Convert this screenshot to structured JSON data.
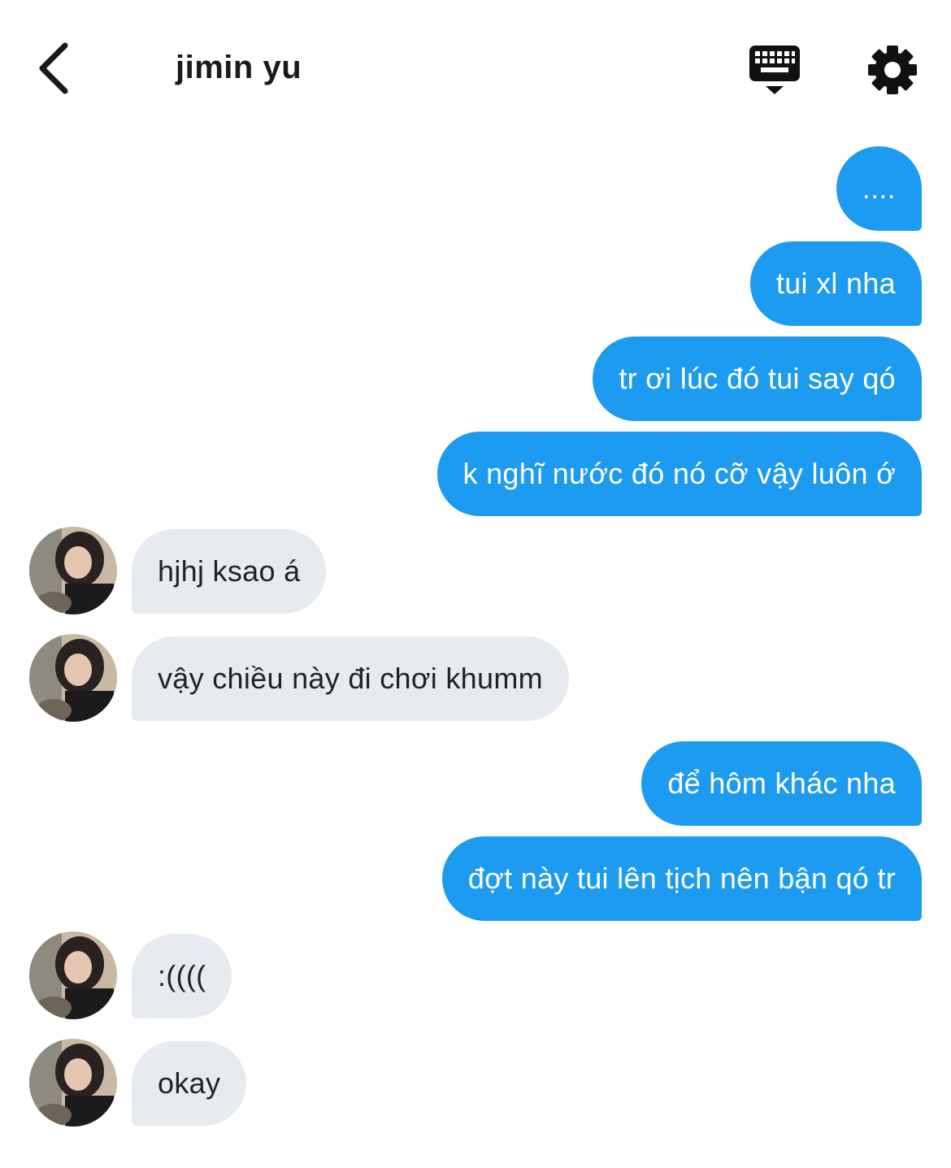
{
  "header": {
    "title": "jimin yu"
  },
  "icons": {
    "back": "chevron-left-icon",
    "keyboard": "keyboard-icon",
    "settings": "gear-icon"
  },
  "colors": {
    "outgoing_bubble": "#1d9bf0",
    "incoming_bubble": "#e7ebef",
    "text_dark": "#1a1a1a"
  },
  "messages": [
    {
      "from": "me",
      "text": "...."
    },
    {
      "from": "me",
      "text": "tui xl nha"
    },
    {
      "from": "me",
      "text": "tr ơi lúc đó tui say qó"
    },
    {
      "from": "me",
      "text": "k nghĩ nước đó nó cỡ vậy luôn ớ"
    },
    {
      "from": "them",
      "text": "hjhj ksao á"
    },
    {
      "from": "them",
      "text": "vậy chiều này đi chơi khumm"
    },
    {
      "from": "me",
      "text": "để hôm khác nha"
    },
    {
      "from": "me",
      "text": "đợt này tui lên tịch nên bận qó tr"
    },
    {
      "from": "them",
      "text": ":(((("
    },
    {
      "from": "them",
      "text": "okay"
    }
  ]
}
